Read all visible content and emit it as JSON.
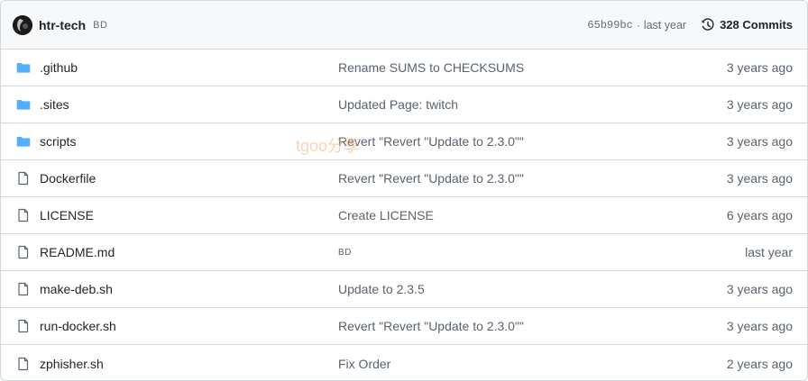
{
  "latest_commit": {
    "author": "htr-tech",
    "message": "BD",
    "sha": "65b99bc",
    "separator": "·",
    "when": "last year",
    "commits_label": "328 Commits"
  },
  "files": [
    {
      "type": "folder",
      "name": ".github",
      "message": "Rename SUMS to CHECKSUMS",
      "age": "3 years ago"
    },
    {
      "type": "folder",
      "name": ".sites",
      "message": "Updated Page: twitch",
      "age": "3 years ago"
    },
    {
      "type": "folder",
      "name": "scripts",
      "message": "Revert \"Revert \"Update to 2.3.0\"\"",
      "age": "3 years ago"
    },
    {
      "type": "file",
      "name": "Dockerfile",
      "message": "Revert \"Revert \"Update to 2.3.0\"\"",
      "age": "3 years ago"
    },
    {
      "type": "file",
      "name": "LICENSE",
      "message": "Create LICENSE",
      "age": "6 years ago"
    },
    {
      "type": "file",
      "name": "README.md",
      "message": "BD",
      "age": "last year"
    },
    {
      "type": "file",
      "name": "make-deb.sh",
      "message": "Update to 2.3.5",
      "age": "3 years ago"
    },
    {
      "type": "file",
      "name": "run-docker.sh",
      "message": "Revert \"Revert \"Update to 2.3.0\"\"",
      "age": "3 years ago"
    },
    {
      "type": "file",
      "name": "zphisher.sh",
      "message": "Fix Order",
      "age": "2 years ago"
    }
  ],
  "watermark": "tgoo分享",
  "colors": {
    "folder": "#54aeff",
    "file_icon": "#59636e",
    "border": "#d0d7de",
    "header_bg": "#f6f8fa"
  }
}
